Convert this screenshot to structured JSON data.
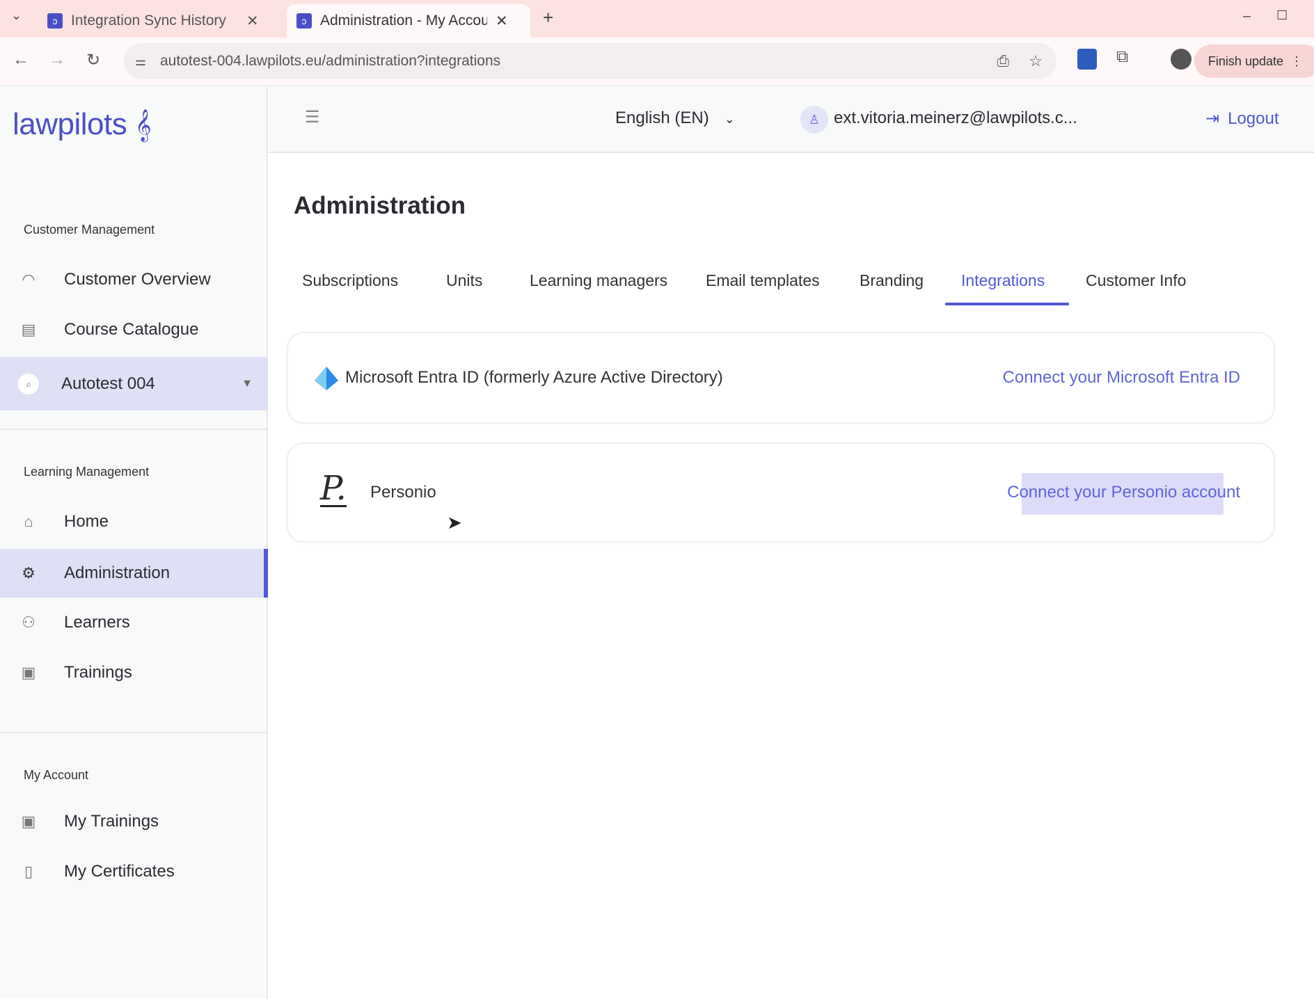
{
  "browser": {
    "tabs": [
      {
        "title": "Integration Sync History",
        "active": false
      },
      {
        "title": "Administration - My Account",
        "active": true
      }
    ],
    "url": "autotest-004.lawpilots.eu/administration?integrations",
    "finish_update": "Finish update"
  },
  "app": {
    "logo": "lawpilots",
    "header": {
      "language": "English (EN)",
      "user_email": "ext.vitoria.meinerz@lawpilots.c...",
      "logout": "Logout"
    },
    "sidebar": {
      "sections": [
        {
          "label": "Customer Management",
          "items": [
            {
              "label": "Customer Overview",
              "icon": "headset-icon"
            },
            {
              "label": "Course Catalogue",
              "icon": "catalogue-icon"
            },
            {
              "label": "Autotest 004",
              "icon": "search-icon"
            }
          ]
        },
        {
          "label": "Learning Management",
          "items": [
            {
              "label": "Home",
              "icon": "home-icon"
            },
            {
              "label": "Administration",
              "icon": "admin-icon"
            },
            {
              "label": "Learners",
              "icon": "users-icon"
            },
            {
              "label": "Trainings",
              "icon": "training-icon"
            }
          ]
        },
        {
          "label": "My Account",
          "items": [
            {
              "label": "My Trainings",
              "icon": "training-icon"
            },
            {
              "label": "My Certificates",
              "icon": "certificate-icon"
            }
          ]
        }
      ]
    },
    "page": {
      "title": "Administration",
      "tabs": [
        "Subscriptions",
        "Units",
        "Learning managers",
        "Email templates",
        "Branding",
        "Integrations",
        "Customer Info"
      ],
      "active_tab": "Integrations",
      "integrations": [
        {
          "name": "Microsoft Entra ID (formerly Azure Active Directory)",
          "action": "Connect your Microsoft Entra ID"
        },
        {
          "name": "Personio",
          "action": "Connect your Personio account"
        }
      ]
    },
    "accent_color": "#5058d6"
  }
}
